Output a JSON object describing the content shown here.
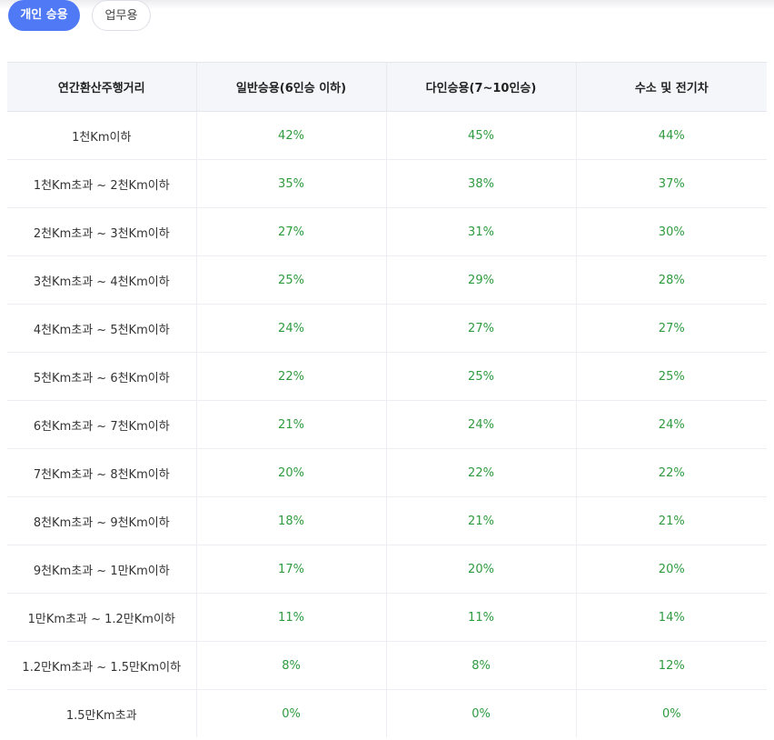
{
  "tabs": [
    {
      "label": "개인 승용",
      "active": true
    },
    {
      "label": "업무용",
      "active": false
    }
  ],
  "table": {
    "headers": [
      "연간환산주행거리",
      "일반승용(6인승 이하)",
      "다인승용(7~10인승)",
      "수소 및 전기차"
    ],
    "rows": [
      [
        "1천Km이하",
        "42%",
        "45%",
        "44%"
      ],
      [
        "1천Km초과 ~ 2천Km이하",
        "35%",
        "38%",
        "37%"
      ],
      [
        "2천Km초과 ~ 3천Km이하",
        "27%",
        "31%",
        "30%"
      ],
      [
        "3천Km초과 ~ 4천Km이하",
        "25%",
        "29%",
        "28%"
      ],
      [
        "4천Km초과 ~ 5천Km이하",
        "24%",
        "27%",
        "27%"
      ],
      [
        "5천Km초과 ~ 6천Km이하",
        "22%",
        "25%",
        "25%"
      ],
      [
        "6천Km초과 ~ 7천Km이하",
        "21%",
        "24%",
        "24%"
      ],
      [
        "7천Km초과 ~ 8천Km이하",
        "20%",
        "22%",
        "22%"
      ],
      [
        "8천Km초과 ~ 9천Km이하",
        "18%",
        "21%",
        "21%"
      ],
      [
        "9천Km초과 ~ 1만Km이하",
        "17%",
        "20%",
        "20%"
      ],
      [
        "1만Km초과 ~ 1.2만Km이하",
        "11%",
        "11%",
        "14%"
      ],
      [
        "1.2만Km초과 ~ 1.5만Km이하",
        "8%",
        "8%",
        "12%"
      ],
      [
        "1.5만Km초과",
        "0%",
        "0%",
        "0%"
      ]
    ]
  },
  "colors": {
    "accent": "#4f79f5",
    "rate_text": "#2e9b3f",
    "header_bg": "#f5f6fa"
  }
}
